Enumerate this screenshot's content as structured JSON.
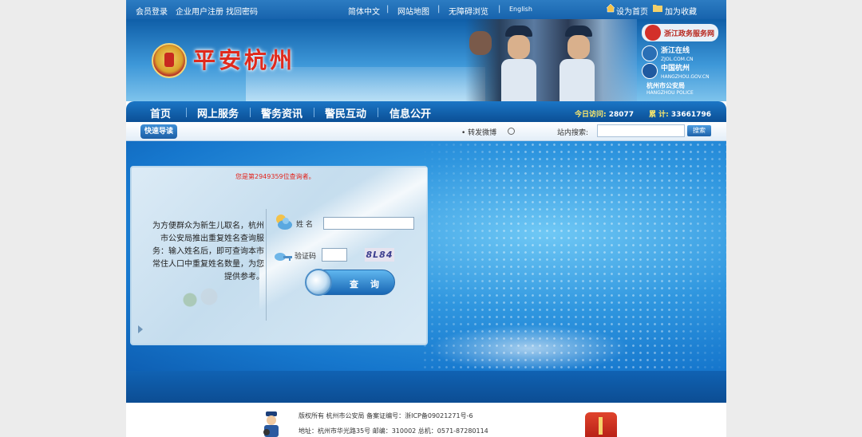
{
  "topbar": {
    "links_left": [
      "会员登录",
      "企业用户注册",
      "找回密码"
    ],
    "links_center": [
      "简体中文",
      "网站地图",
      "无障碍浏览",
      "English"
    ],
    "separator": "|",
    "set_home": "设为首页",
    "bookmark": "加为收藏"
  },
  "banner": {
    "logo_text": "平安杭州",
    "partners": [
      {
        "name": "浙江政务服务网",
        "sub": ""
      },
      {
        "name": "浙江在线",
        "sub": "ZJOL.COM.CN"
      },
      {
        "name": "中国杭州",
        "sub": "HANGZHOU.GOV.CN"
      },
      {
        "name": "杭州市公安局",
        "sub": "HANGZHOU POLICE"
      }
    ]
  },
  "nav": {
    "items": [
      "首页",
      "网上服务",
      "警务资讯",
      "警民互动",
      "信息公开"
    ],
    "today_label": "今日访问:",
    "today_value": "28077",
    "total_label": "累 计:",
    "total_value": "33661796"
  },
  "subbar": {
    "quick_guide": "快速导读",
    "weibo": "转发微博",
    "search_label": "站内搜索:",
    "search_placeholder": "",
    "search_button": "搜索"
  },
  "panel": {
    "counter_text": "您是第2949359位查询者。",
    "intro": "为方便群众为新生儿取名，杭州市公安局推出重复姓名查询服务：输入姓名后，即可查询本市常住人口中重复姓名数量，为您提供参考。",
    "name_label": "姓 名",
    "name_value": "",
    "code_label": "验证码",
    "code_value": "",
    "captcha_text": "8L84",
    "query_button": "查 询"
  },
  "footer": {
    "line1": "版权所有 杭州市公安局 备案证编号：浙ICP备09021271号-6",
    "line2": "地址：杭州市华光路35号 邮编：310002 总机：0571-87280114"
  },
  "colors": {
    "primary_blue": "#1763ad",
    "logo_red": "#e02a1c",
    "counter_red": "#e3231b",
    "stat_yellow": "#ffea6a"
  }
}
